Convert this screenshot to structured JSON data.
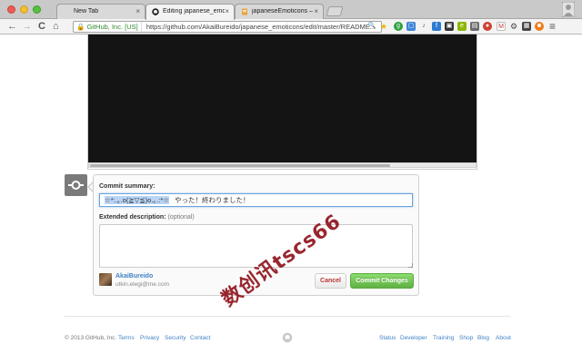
{
  "browser": {
    "tabs": [
      {
        "label": "New Tab",
        "active": false
      },
      {
        "label": "Editing japanese_emoticons",
        "active": true
      },
      {
        "label": "japaneseEmoticons – Edit",
        "active": false
      }
    ],
    "address": {
      "ev_label": "GitHub, Inc. [US]",
      "url": "https://github.com/AkaiBureido/japanese_emoticons/edit/master/README..."
    },
    "nav": {
      "back": "←",
      "forward": "→",
      "reload": "C",
      "home": "⌂",
      "menu": "≡"
    }
  },
  "commit_form": {
    "summary_label": "Commit summary:",
    "summary_selected": "☆*:.｡.o(≧▽≦)o.｡.:*☆",
    "summary_rest": "やった！終わりました！",
    "description_label": "Extended description:",
    "description_optional": "(optional)",
    "description_value": "",
    "author_name": "AkaiBureido",
    "author_email": "utkin.elegi@me.com",
    "cancel_label": "Cancel",
    "commit_label": "Commit Changes"
  },
  "footer": {
    "copyright": "© 2013 GitHub, Inc.",
    "left_links": [
      "Terms",
      "Privacy",
      "Security",
      "Contact"
    ],
    "right_links": [
      "Status",
      "Developer",
      "Training",
      "Shop",
      "Blog",
      "About"
    ]
  },
  "watermark": "数创讯tscs66",
  "colors": {
    "link": "#4183c4",
    "commit_green": "#60b044",
    "cancel_red": "#bb3333",
    "video_bg": "#141414",
    "ev_green": "#2e8a2e"
  }
}
